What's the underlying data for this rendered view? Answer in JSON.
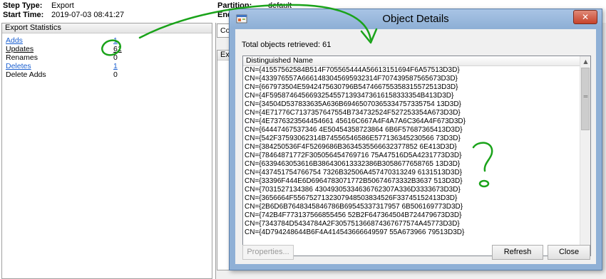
{
  "background": {
    "step_type_label": "Step Type:",
    "step_type_value": "Export",
    "start_time_label": "Start Time:",
    "start_time_value": "2019-07-03 08:41:27",
    "partition_label": "Partition:",
    "partition_value": "default",
    "end_label_partial": "End",
    "stats_header": "Export Statistics",
    "stats": [
      {
        "label": "Adds",
        "value": "1"
      },
      {
        "label": "Updates",
        "value": "61"
      },
      {
        "label": "Renames",
        "value": "0"
      },
      {
        "label": "Deletes",
        "value": "1"
      },
      {
        "label": "Delete Adds",
        "value": "0"
      }
    ],
    "right_box1_label": "Co",
    "right_box2_label": "Exp"
  },
  "dialog": {
    "title": "Object Details",
    "close_glyph": "✕",
    "total_text": "Total objects retrieved: 61",
    "column_header": "Distinguished Name",
    "rows": [
      "CN={41557562584B514F705565444A56613151694F6A57513D3D}",
      "CN={433976557A6661483045695932314F707439587565673D3D}",
      "CN={667973504E5942475630796B547466755358315572513D3D}",
      "CN={4F59587464566932545571393473616158333354B413D3D}",
      "CN={34504D537833635A636B69465070365334757335754 13D3D}",
      "CN={4E71776C7137357647554B734732524F527253354A673D3D}",
      "CN={4E7376323564454661 45616C667A4F4A7A6C364A4F673D3D}",
      "CN={64447467537346 4E50454358723864 6B6F57687365413D3D}",
      "CN={542F37593062314B74556546586E577136345230566 73D3D}",
      "CN={384250536F4F5269686B3634535566632377852 6E413D3D}",
      "CN={78464871772F305056454769716 75A47516D5A4231773D3D}",
      "CN={6339463053616B386430613332386B3058677658765 13D3D}",
      "CN={437451754766754 7326B32506A457470313249 6131513D3D}",
      "CN={33396F444E6D6964783071772B50674673332B3637 513D3D}",
      "CN={7031527134386 43049305334636762307A336D3333673D3D}",
      "CN={3656664F5567527132307948503834526F33745152413D3D}",
      "CN={2B6D6B7648345846786B69545337317957 6B506169773D3D}",
      "CN={742B4F773137566855456 52B2F647364504B724479673D3D}",
      "CN={7343784D5434784A2F305751366874367677574A45773D3D}",
      "CN={4D794248644B6F4A414543666649597 55A673966 79513D3D}"
    ],
    "properties_label": "Properties...",
    "refresh_label": "Refresh",
    "close_label": "Close"
  },
  "annotations": {
    "color": "#1aa31a",
    "question_mark": "?"
  },
  "colors": {
    "dialog_frame": "#8fb0d6",
    "close_button": "#c7432b",
    "link": "#1a5fd0"
  }
}
